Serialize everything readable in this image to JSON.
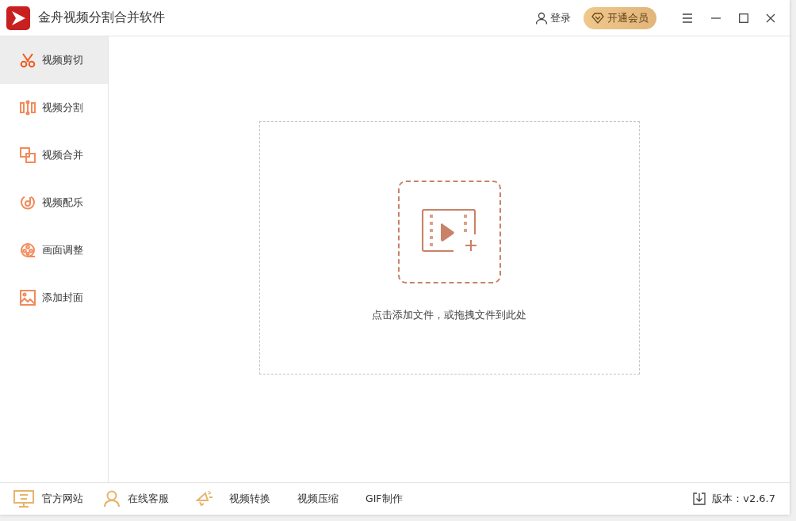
{
  "window": {
    "title": "金舟视频分割合并软件"
  },
  "header": {
    "login": "登录",
    "vip": "开通会员"
  },
  "sidebar": {
    "items": [
      {
        "label": "视频剪切",
        "kind": "scissors",
        "selected": true
      },
      {
        "label": "视频分割",
        "kind": "split",
        "selected": false
      },
      {
        "label": "视频合并",
        "kind": "merge",
        "selected": false
      },
      {
        "label": "视频配乐",
        "kind": "music",
        "selected": false
      },
      {
        "label": "画面调整",
        "kind": "reel",
        "selected": false
      },
      {
        "label": "添加封面",
        "kind": "image",
        "selected": false
      }
    ]
  },
  "dropzone": {
    "hint": "点击添加文件，或拖拽文件到此处"
  },
  "footer": {
    "links": [
      {
        "label": "官方网站",
        "kind": "monitor"
      },
      {
        "label": "在线客服",
        "kind": "person"
      }
    ],
    "tools": [
      "视频转换",
      "视频压缩",
      "GIF制作"
    ],
    "version": "版本：v2.6.7"
  }
}
